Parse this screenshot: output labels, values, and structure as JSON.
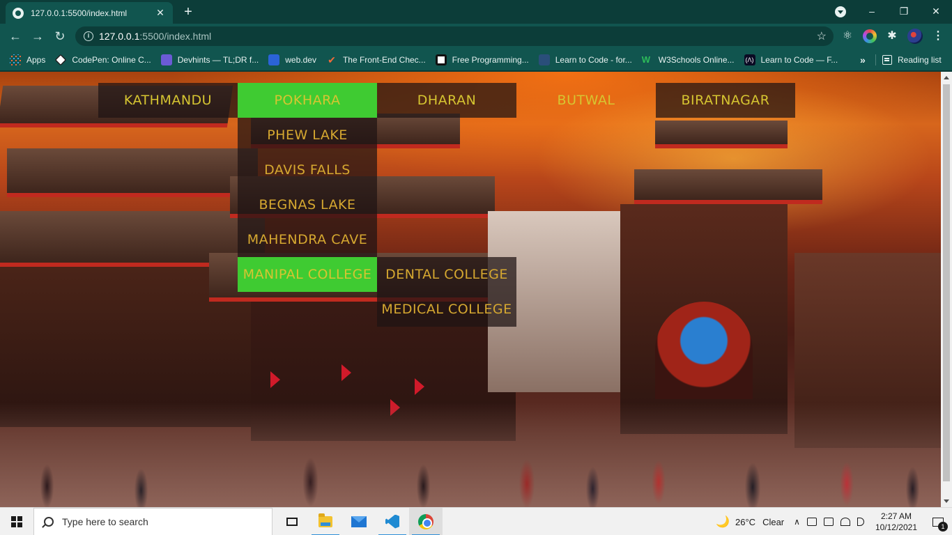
{
  "browser": {
    "tab_title": "127.0.0.1:5500/index.html",
    "tab_close": "✕",
    "new_tab": "+",
    "url_host": "127.0.0.1",
    "url_rest": ":5500/index.html",
    "window_controls": {
      "minimize": "–",
      "restore": "❐",
      "close": "✕"
    },
    "nav": {
      "back": "←",
      "forward": "→",
      "reload": "↻"
    },
    "star": "☆",
    "ext_react": "⚛",
    "ext_puzzle": "✱",
    "menu": "⋮"
  },
  "bookmarks": {
    "apps": "Apps",
    "items": [
      {
        "label": "CodePen: Online C...",
        "icon": "codepen-icon"
      },
      {
        "label": "Devhints — TL;DR f...",
        "icon": "devhints-icon"
      },
      {
        "label": "web.dev",
        "icon": "webdev-icon"
      },
      {
        "label": "The Front-End Chec...",
        "icon": "checkmark-icon"
      },
      {
        "label": "Free Programming...",
        "icon": "freeprog-icon"
      },
      {
        "label": "Learn to Code - for...",
        "icon": "learncode-icon"
      },
      {
        "label": "W3Schools Online...",
        "icon": "w3schools-icon"
      },
      {
        "label": "Learn to Code — F...",
        "icon": "freecodecamp-icon"
      }
    ],
    "more": "»",
    "reading_list": "Reading list"
  },
  "page": {
    "nav": [
      {
        "label": "KATHMANDU"
      },
      {
        "label": "POKHARA"
      },
      {
        "label": "DHARAN"
      },
      {
        "label": "BUTWAL"
      },
      {
        "label": "BIRATNAGAR"
      }
    ],
    "pokhara_sub": [
      {
        "label": "PHEW LAKE"
      },
      {
        "label": "DAVIS FALLS"
      },
      {
        "label": "BEGNAS LAKE"
      },
      {
        "label": "MAHENDRA CAVE"
      },
      {
        "label": "MANIPAL COLLEGE"
      }
    ],
    "manipal_sub": [
      {
        "label": "DENTAL COLLEGE"
      },
      {
        "label": "MEDICAL COLLEGE"
      }
    ],
    "colors": {
      "active": "#3fcb32",
      "text": "#d6c531",
      "sub_text": "#d6a830"
    }
  },
  "taskbar": {
    "search_placeholder": "Type here to search",
    "weather_temp": "26°C",
    "weather_cond": "Clear",
    "time": "2:27 AM",
    "date": "10/12/2021",
    "notif_count": "1",
    "moon": "🌙",
    "tray_up": "∧"
  }
}
